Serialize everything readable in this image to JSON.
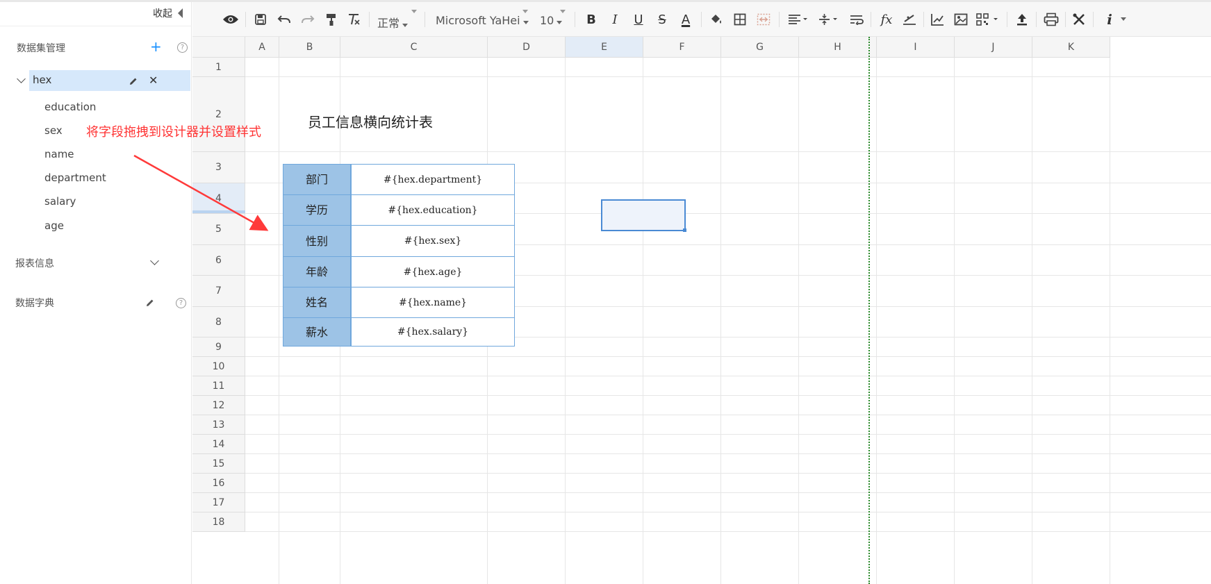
{
  "sidebar": {
    "collapse_label": "收起",
    "dataset_section_title": "数据集管理",
    "add_icon": "plus-icon",
    "dataset": {
      "name": "hex",
      "fields": [
        "education",
        "sex",
        "name",
        "department",
        "salary",
        "age"
      ]
    },
    "report_info_title": "报表信息",
    "dictionary_title": "数据字典",
    "help_glyph": "?"
  },
  "annotation": "将字段拖拽到设计器并设置样式",
  "toolbar": {
    "style_select": "正常",
    "font_select": "Microsoft YaHei",
    "size_select": "10",
    "icons": [
      "preview-icon",
      "save-icon",
      "undo-icon",
      "redo-icon",
      "format-painter-icon",
      "clear-format-icon",
      "bold-icon",
      "italic-icon",
      "underline-icon",
      "strikethrough-icon",
      "font-color-icon",
      "fill-color-icon",
      "border-icon",
      "merge-cells-icon",
      "align-icon",
      "vertical-align-icon",
      "wrap-text-icon",
      "function-icon",
      "chart-icon",
      "image-icon",
      "qrcode-icon",
      "upload-icon",
      "print-icon",
      "tools-icon",
      "info-icon"
    ],
    "font_color_accent": "#1a1a1a",
    "glyphs": {
      "bold": "B",
      "italic": "I",
      "underline": "U",
      "strike": "S",
      "font_color": "A",
      "function": "fx",
      "info": "i"
    }
  },
  "grid": {
    "columns": [
      "A",
      "B",
      "C",
      "D",
      "E",
      "F",
      "G",
      "H",
      "I",
      "J",
      "K"
    ],
    "rows": [
      "1",
      "2",
      "3",
      "4",
      "5",
      "6",
      "7",
      "8",
      "9",
      "10",
      "11",
      "12",
      "13",
      "14",
      "15",
      "16",
      "17",
      "18"
    ],
    "selected_column": "E",
    "selected_row": "4",
    "report_title": "员工信息横向统计表",
    "table": [
      {
        "label": "部门",
        "value": "#{hex.department}"
      },
      {
        "label": "学历",
        "value": "#{hex.education}"
      },
      {
        "label": "性别",
        "value": "#{hex.sex}"
      },
      {
        "label": "年龄",
        "value": "#{hex.age}"
      },
      {
        "label": "姓名",
        "value": "#{hex.name}"
      },
      {
        "label": "薪水",
        "value": "#{hex.salary}"
      }
    ],
    "colors": {
      "label_fill": "#9dc3e6",
      "border": "#6fa7dc",
      "selection": "#4a8ad4",
      "page_break": "#2a8a2a"
    }
  }
}
